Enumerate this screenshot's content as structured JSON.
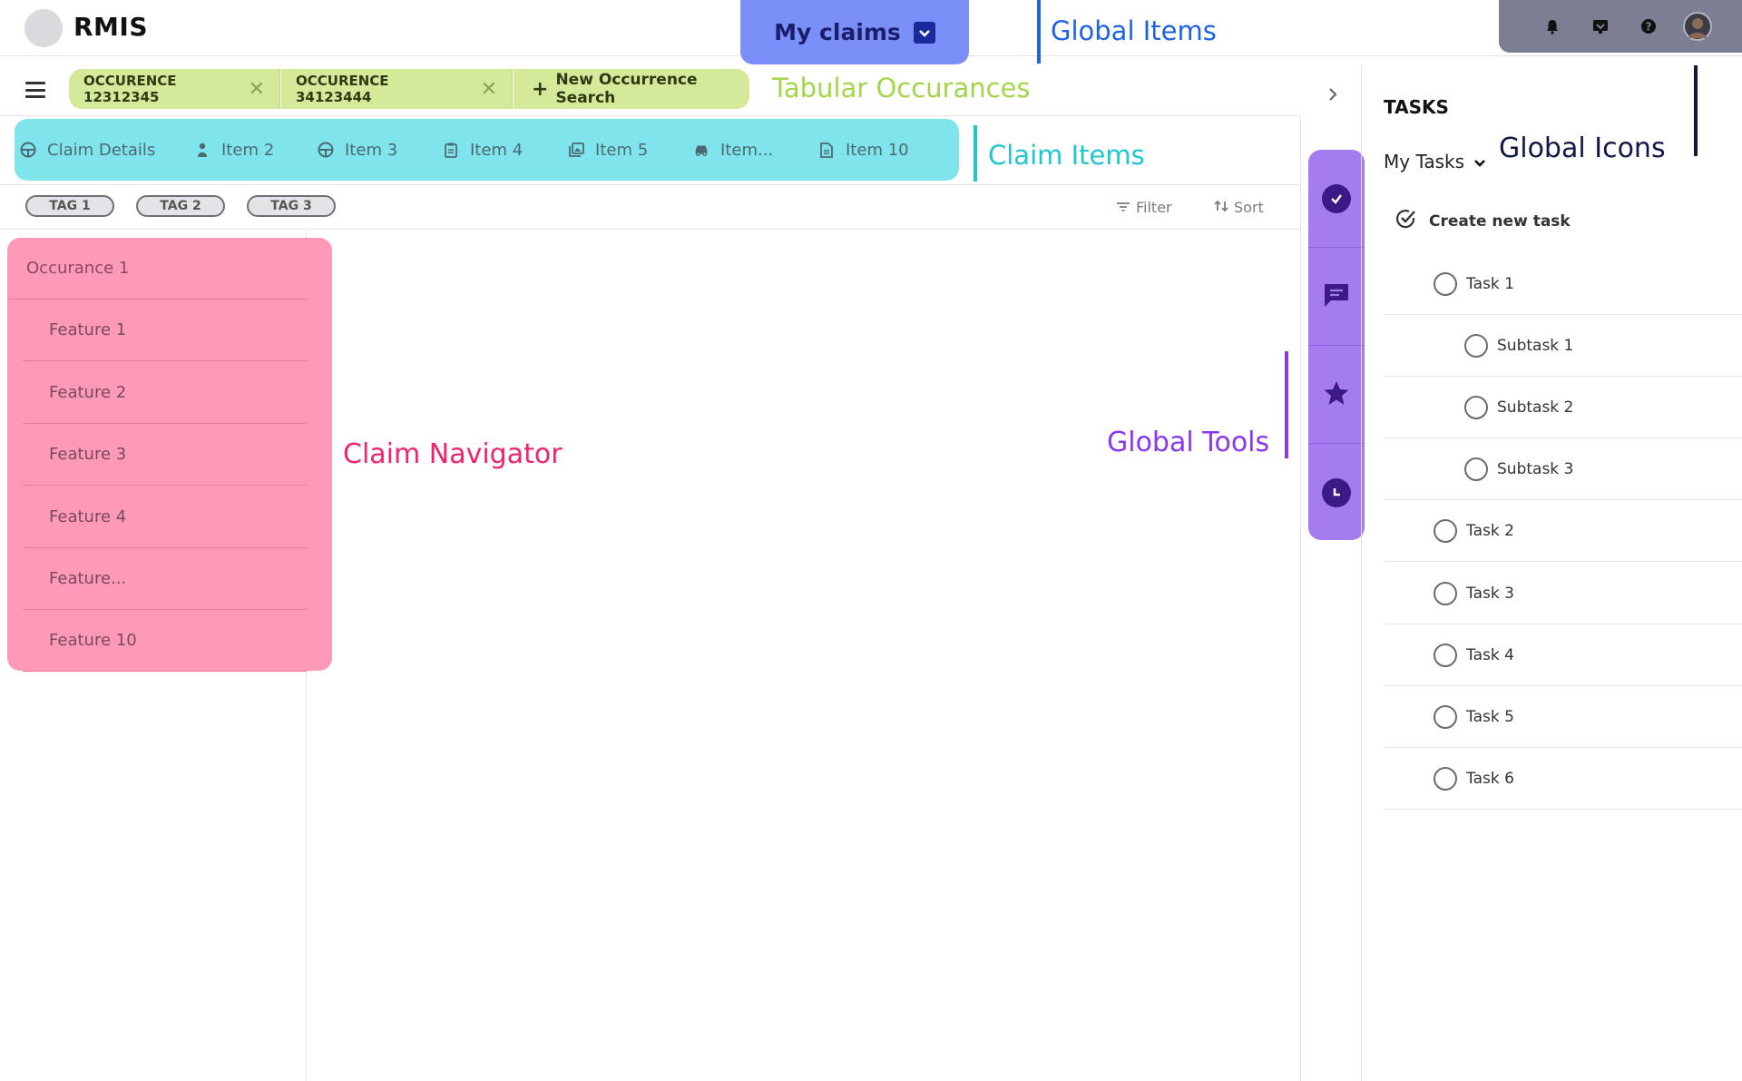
{
  "header": {
    "app_title": "RMIS",
    "my_claims_label": "My claims",
    "global_items_label": "Global Items",
    "icons": [
      "bell-icon",
      "inbox-icon",
      "help-icon",
      "user-avatar"
    ]
  },
  "occurrence_tabs": {
    "tabs": [
      {
        "label": "OCCURENCE 12312345"
      },
      {
        "label": "OCCURENCE 34123444"
      }
    ],
    "new_search_label": "New Occurrence Search",
    "annotation": "Tabular Occurances"
  },
  "claim_items": {
    "items": [
      {
        "label": "Claim Details",
        "icon": "steering-wheel-icon"
      },
      {
        "label": "Item 2",
        "icon": "person-icon"
      },
      {
        "label": "Item 3",
        "icon": "steering-wheel-icon"
      },
      {
        "label": "Item 4",
        "icon": "clipboard-icon"
      },
      {
        "label": "Item 5",
        "icon": "photos-icon"
      },
      {
        "label": "Item...",
        "icon": "car-icon"
      },
      {
        "label": "Item 10",
        "icon": "document-icon"
      }
    ],
    "annotation": "Claim Items"
  },
  "tags": [
    "TAG 1",
    "TAG 2",
    "TAG 3"
  ],
  "toolbar": {
    "filter_label": "Filter",
    "sort_label": "Sort"
  },
  "claim_navigator": {
    "occurrence": "Occurance 1",
    "features": [
      "Feature 1",
      "Feature 2",
      "Feature 3",
      "Feature 4",
      "Feature...",
      "Feature 10"
    ],
    "annotation": "Claim Navigator"
  },
  "global_tools": {
    "tools": [
      "check-circle-icon",
      "chat-icon",
      "star-icon",
      "clock-icon"
    ],
    "annotation": "Global Tools"
  },
  "tasks": {
    "title": "TASKS",
    "filter_label": "My Tasks",
    "create_label": "Create new task",
    "annotation": "Global Icons",
    "items": [
      {
        "label": "Task 1",
        "level": 0
      },
      {
        "label": "Subtask 1",
        "level": 1
      },
      {
        "label": "Subtask 2",
        "level": 1
      },
      {
        "label": "Subtask 3",
        "level": 1
      },
      {
        "label": "Task 2",
        "level": 0
      },
      {
        "label": "Task 3",
        "level": 0
      },
      {
        "label": "Task 4",
        "level": 0
      },
      {
        "label": "Task 5",
        "level": 0
      },
      {
        "label": "Task 6",
        "level": 0
      }
    ]
  },
  "colors": {
    "my_claims_bg": "#7b8ff8",
    "occurrence_tab_bg": "#d4ea9a",
    "claim_items_bg": "#80e4ec",
    "navigator_bg": "#fe99b8",
    "tools_bg": "#a57cee",
    "global_icons_bg": "#7c7f94"
  }
}
